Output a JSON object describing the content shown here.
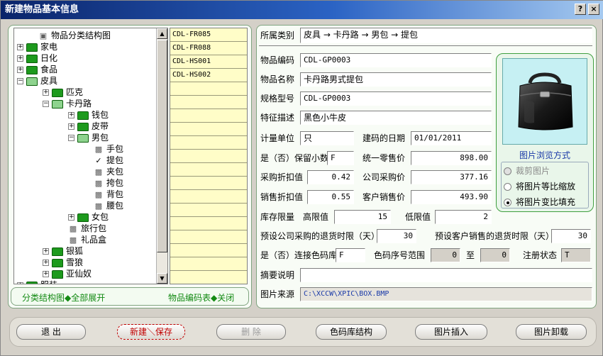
{
  "window": {
    "title": "新建物品基本信息",
    "help_icon": "help-icon",
    "close_icon": "close-icon"
  },
  "tree": {
    "nodes": [
      {
        "label": "物品分类结构图",
        "icon": "tree-root-icon",
        "depth": 0
      },
      {
        "label": "家电",
        "depth": 0,
        "expanded": false
      },
      {
        "label": "日化",
        "depth": 0,
        "expanded": false
      },
      {
        "label": "食品",
        "depth": 0,
        "expanded": false
      },
      {
        "label": "皮具",
        "depth": 0,
        "expanded": true
      },
      {
        "label": "匹克",
        "depth": 1,
        "expanded": false
      },
      {
        "label": "卡丹路",
        "depth": 1,
        "expanded": true
      },
      {
        "label": "钱包",
        "depth": 2,
        "expanded": false
      },
      {
        "label": "皮带",
        "depth": 2,
        "expanded": false
      },
      {
        "label": "男包",
        "depth": 2,
        "expanded": true
      },
      {
        "label": "手包",
        "depth": 3,
        "leaf": true
      },
      {
        "label": "提包",
        "depth": 3,
        "leaf": true,
        "checked": true
      },
      {
        "label": "夹包",
        "depth": 3,
        "leaf": true
      },
      {
        "label": "挎包",
        "depth": 3,
        "leaf": true
      },
      {
        "label": "背包",
        "depth": 3,
        "leaf": true
      },
      {
        "label": "腰包",
        "depth": 3,
        "leaf": true
      },
      {
        "label": "女包",
        "depth": 2,
        "expanded": false
      },
      {
        "label": "旅行包",
        "depth": 2,
        "leaf": true
      },
      {
        "label": "礼品盒",
        "depth": 2,
        "leaf": true
      },
      {
        "label": "银狐",
        "depth": 1,
        "expanded": false
      },
      {
        "label": "雪狼",
        "depth": 1,
        "expanded": false
      },
      {
        "label": "亚仙奴",
        "depth": 1,
        "expanded": false
      },
      {
        "label": "服装",
        "depth": 0,
        "expanded": false
      }
    ]
  },
  "codes": [
    "CDL-FR085",
    "CDL-FR088",
    "CDL-HS001",
    "CDL-HS002",
    "",
    "",
    "",
    "",
    "",
    "",
    "",
    "",
    "",
    "",
    "",
    "",
    "",
    "",
    ""
  ],
  "left_footer": {
    "expand_all": "分类结构图◆全部展开",
    "close_codes": "物品编码表◆关闭"
  },
  "form": {
    "category_label": "所属类别",
    "category_value": "皮具 → 卡丹路 → 男包 → 提包",
    "code_label": "物品编码",
    "code_value": "CDL-GP0003",
    "name_label": "物品名称",
    "name_value": "卡丹路男式提包",
    "spec_label": "规格型号",
    "spec_value": "CDL-GP0003",
    "feature_label": "特征描述",
    "feature_value": "黑色小牛皮",
    "unit_label": "计量单位",
    "unit_value": "只",
    "date_label": "建码的日期",
    "date_value": "01/01/2011",
    "decimal_label": "是（否）保留小数",
    "decimal_value": "F",
    "retail_label": "统一零售价",
    "retail_value": "898.00",
    "purchase_disc_label": "采购折扣值",
    "purchase_disc_value": "0.42",
    "company_purchase_label": "公司采购价",
    "company_purchase_value": "377.16",
    "sales_disc_label": "销售折扣值",
    "sales_disc_value": "0.55",
    "customer_sale_label": "客户销售价",
    "customer_sale_value": "493.90",
    "stock_limit_label": "库存限量",
    "high_label": "高限值",
    "high_value": "15",
    "low_label": "低限值",
    "low_value": "2",
    "purchase_return_label": "预设公司采购的退货时限（天）",
    "purchase_return_value": "30",
    "sales_return_label": "预设客户销售的退货时限（天）",
    "sales_return_value": "30",
    "color_link_label": "是（否）连接色码库",
    "color_link_value": "F",
    "color_range_label": "色码序号范围",
    "color_from": "0",
    "to_label": "至",
    "color_to": "0",
    "reg_label": "注册状态",
    "reg_value": "T",
    "summary_label": "摘要说明",
    "summary_value": "",
    "source_label": "图片来源",
    "source_value": "C:\\XCCW\\XPIC\\BOX.BMP"
  },
  "image_panel": {
    "image": "briefcase-image",
    "mode_title": "图片浏览方式",
    "options": [
      {
        "label": "裁剪图片",
        "selected": false,
        "disabled": true
      },
      {
        "label": "将图片等比缩放",
        "selected": false,
        "disabled": false
      },
      {
        "label": "将图片变比填充",
        "selected": true,
        "disabled": false
      }
    ]
  },
  "buttons": {
    "exit": "退 出",
    "new_save": "新建＼保存",
    "delete": "删 除",
    "color_lib": "色码库结构",
    "insert_pic": "图片插入",
    "unload_pic": "图片卸载"
  }
}
